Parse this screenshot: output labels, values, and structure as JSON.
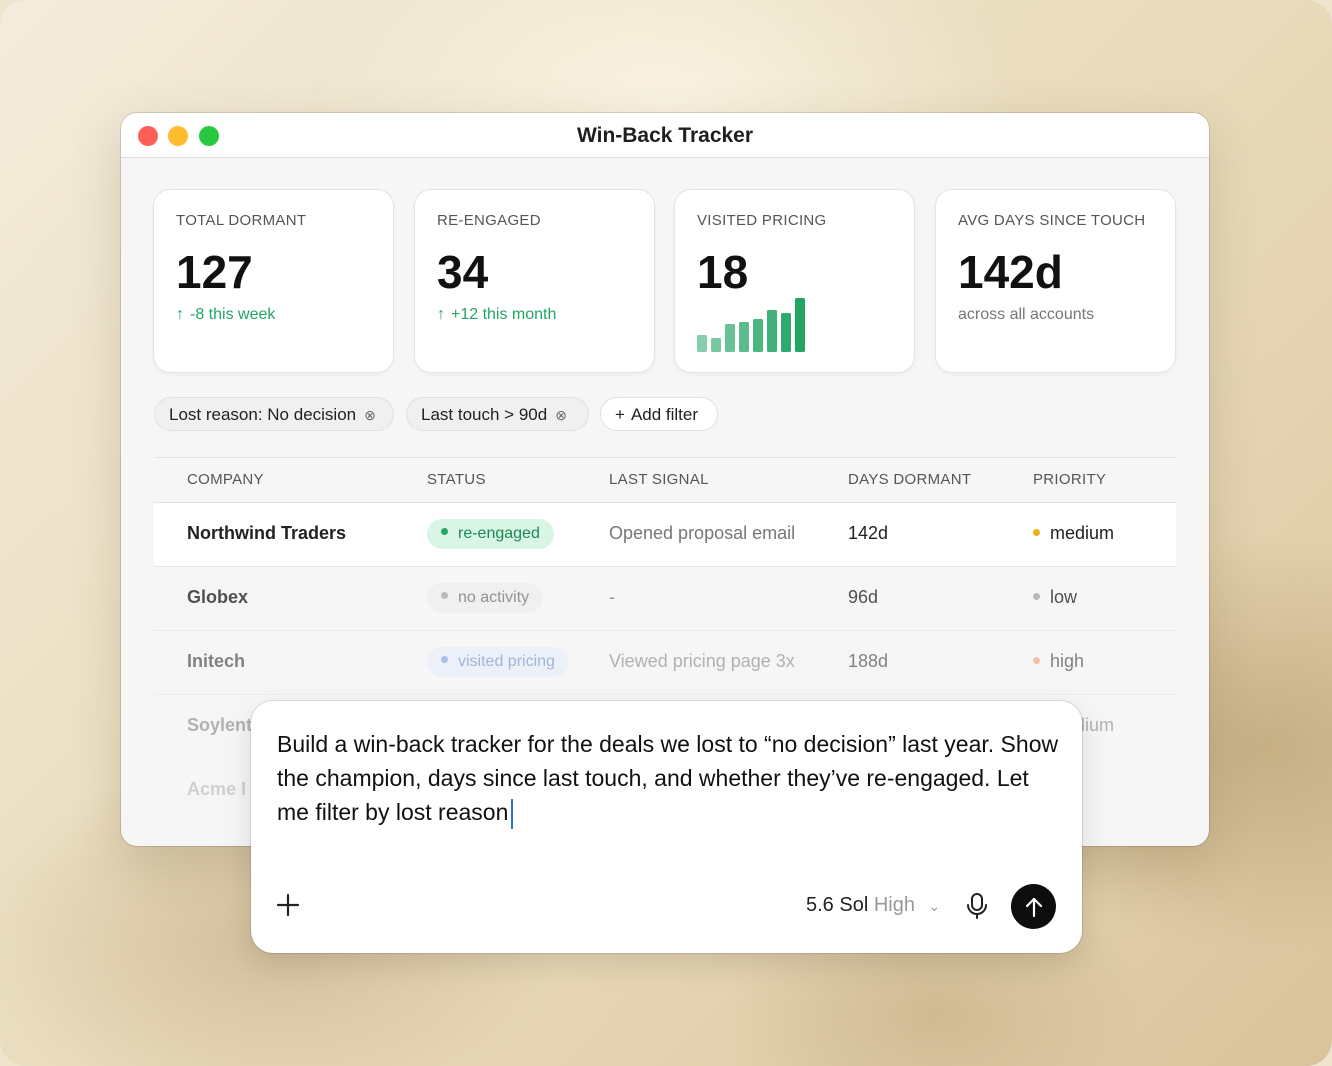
{
  "window": {
    "title": "Win-Back Tracker"
  },
  "cards": [
    {
      "label": "TOTAL DORMANT",
      "value": "127",
      "delta": "-8 this week",
      "delta_icon": "arrow-up-icon"
    },
    {
      "label": "RE-ENGAGED",
      "value": "34",
      "delta": "+12 this month",
      "delta_icon": "arrow-up-icon"
    },
    {
      "label": "VISITED PRICING",
      "value": "18",
      "spark_values": [
        3,
        2.6,
        5,
        5.3,
        6,
        7.6,
        7,
        9.7
      ]
    },
    {
      "label": "AVG DAYS SINCE TOUCH",
      "value": "142d",
      "sub": "across all accounts"
    }
  ],
  "filters": [
    {
      "label": "Lost reason: No decision",
      "icon": "clear-icon"
    },
    {
      "label": "Last touch > 90d",
      "icon": "clear-icon"
    }
  ],
  "add_filter": {
    "icon": "plus-icon",
    "label": "Add filter"
  },
  "table": {
    "headers": {
      "company": "COMPANY",
      "status": "STATUS",
      "signal": "LAST SIGNAL",
      "days": "DAYS DORMANT",
      "priority": "PRIORITY"
    },
    "rows": [
      {
        "company": "Northwind Traders",
        "status": "re-engaged",
        "signal": "Opened proposal email",
        "days": "142d",
        "priority": "medium"
      },
      {
        "company": "Globex",
        "status": "no activity",
        "signal": "-",
        "days": "96d",
        "priority": "low"
      },
      {
        "company": "Initech",
        "status": "visited pricing",
        "signal": "Viewed pricing page 3x",
        "days": "188d",
        "priority": "high"
      },
      {
        "company": "Soylent",
        "priority": "medium"
      },
      {
        "company": "Acme I",
        "priority": "h"
      }
    ]
  },
  "colors": {
    "green": "#22a565",
    "badge_green_bg": "#d9f5e5",
    "badge_green_fg": "#1a8a52",
    "badge_gray_bg": "#efefef",
    "badge_gray_fg": "#777777",
    "badge_blue_bg": "#e4ecfa",
    "badge_blue_fg": "#5b7fc7",
    "medium": "#e9b31c",
    "low": "#aaaaaa",
    "high": "#f0956b"
  },
  "prompt": {
    "text": "Build a win-back tracker for the deals we lost to “no decision” last year. Show the champion, days since last touch, and whether they’ve re-engaged. Let me filter by lost reason",
    "model": "5.6 Sol",
    "effort": "High"
  }
}
